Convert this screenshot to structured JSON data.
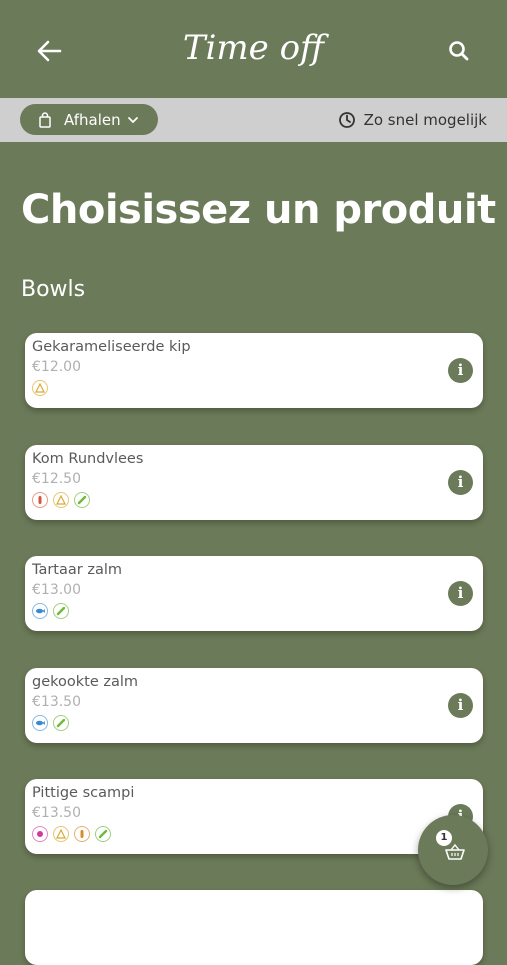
{
  "header": {
    "logo_text": "Time off"
  },
  "subbar": {
    "pickup_label": "Afhalen",
    "time_label": "Zo snel mogelijk"
  },
  "page": {
    "title": "Choisissez un produit",
    "section_title": "Bowls"
  },
  "products": [
    {
      "name": "Gekarameliseerde kip",
      "price": "€12.00",
      "allergens": [
        "peanut-icon"
      ]
    },
    {
      "name": "Kom Rundvlees",
      "price": "€12.50",
      "allergens": [
        "sauce-icon",
        "peanut-icon",
        "soy-icon"
      ]
    },
    {
      "name": "Tartaar zalm",
      "price": "€13.00",
      "allergens": [
        "fish-icon",
        "soy-icon"
      ]
    },
    {
      "name": "gekookte zalm",
      "price": "€13.50",
      "allergens": [
        "fish-icon",
        "soy-icon"
      ]
    },
    {
      "name": "Pittige scampi",
      "price": "€13.50",
      "allergens": [
        "shellfish-icon",
        "peanut-icon",
        "sauce-icon",
        "soy-icon"
      ]
    }
  ],
  "cart": {
    "count": "1"
  },
  "colors": {
    "brand": "#6b7a58",
    "bar": "#cfcfcf"
  }
}
